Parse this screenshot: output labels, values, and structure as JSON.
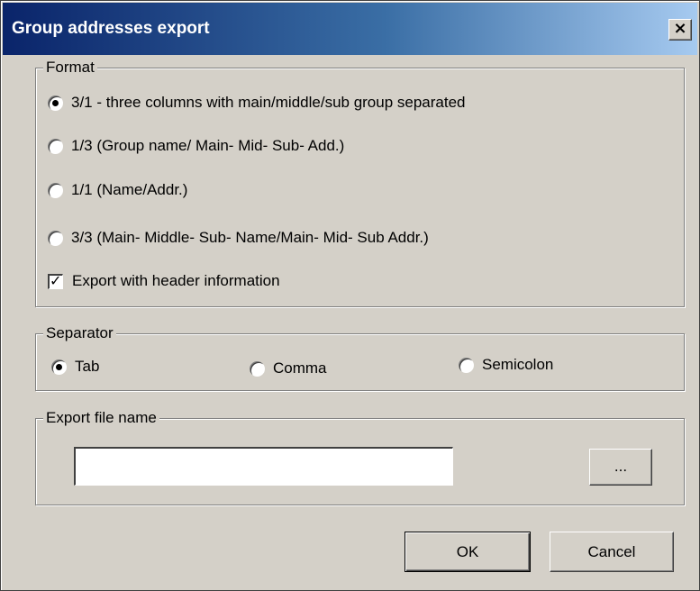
{
  "window": {
    "title": "Group addresses export",
    "close_label": "×"
  },
  "format": {
    "legend": "Format",
    "options": [
      {
        "label": "3/1 - three columns with main/middle/sub group separated",
        "checked": true
      },
      {
        "label": "1/3 (Group name/ Main-  Mid- Sub- Add.)",
        "checked": false
      },
      {
        "label": "1/1 (Name/Addr.)",
        "checked": false
      },
      {
        "label": "3/3 (Main- Middle- Sub- Name/Main- Mid- Sub Addr.)",
        "checked": false
      }
    ],
    "header_checkbox": {
      "label": "Export with header information",
      "checked": true
    }
  },
  "separator": {
    "legend": "Separator",
    "options": [
      {
        "label": "Tab",
        "checked": true
      },
      {
        "label": "Comma",
        "checked": false
      },
      {
        "label": "Semicolon",
        "checked": false
      }
    ]
  },
  "export_file": {
    "legend": "Export file name",
    "value": "",
    "browse_label": "..."
  },
  "buttons": {
    "ok": "OK",
    "cancel": "Cancel"
  }
}
